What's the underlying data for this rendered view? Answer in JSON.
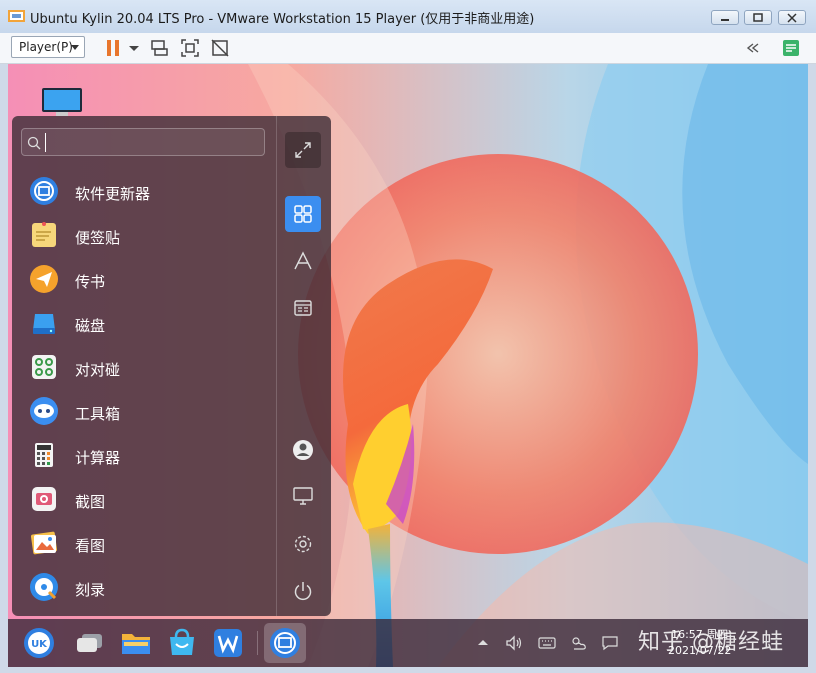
{
  "window": {
    "title": "Ubuntu Kylin 20.04 LTS Pro - VMware Workstation 15 Player (仅用于非商业用途)",
    "buttons": [
      "minimize",
      "maximize",
      "close"
    ]
  },
  "toolbar": {
    "player_label": "Player(P)",
    "icons": [
      "pause-icon",
      "dropdown-icon",
      "send-ctrl-alt-del-icon",
      "fit-guest-icon",
      "unity-icon",
      "collapse-icon",
      "notes-icon"
    ]
  },
  "start_menu": {
    "search_value": "",
    "apps": [
      {
        "label": "软件更新器",
        "icon": "software-updater-icon"
      },
      {
        "label": "便签贴",
        "icon": "sticky-notes-icon"
      },
      {
        "label": "传书",
        "icon": "paper-plane-icon"
      },
      {
        "label": "磁盘",
        "icon": "disk-icon"
      },
      {
        "label": "对对碰",
        "icon": "game-icon"
      },
      {
        "label": "工具箱",
        "icon": "toolbox-icon"
      },
      {
        "label": "计算器",
        "icon": "calculator-icon"
      },
      {
        "label": "截图",
        "icon": "screenshot-icon"
      },
      {
        "label": "看图",
        "icon": "image-viewer-icon"
      },
      {
        "label": "刻录",
        "icon": "burner-icon"
      }
    ],
    "sidebar": [
      "expand-icon",
      "all-apps-icon",
      "letter-sort-icon",
      "category-icon",
      "user-icon",
      "computer-icon",
      "settings-icon",
      "power-icon"
    ]
  },
  "taskbar": {
    "clock_time": "16:57 周四",
    "clock_date": "2021/07/22",
    "watermark": "知乎 @糖经蛙",
    "apps": [
      "kylin-start-icon",
      "multitask-icon",
      "file-manager-icon",
      "app-store-icon",
      "wps-icon",
      "software-updater-icon"
    ],
    "tray": [
      "tray-up-arrow-icon",
      "volume-icon",
      "keyboard-icon",
      "weather-icon",
      "notification-icon"
    ]
  },
  "colors": {
    "menu_bg": "#402e38",
    "accent": "#3b8ef0",
    "taskbar_bg": "#3a2838"
  }
}
